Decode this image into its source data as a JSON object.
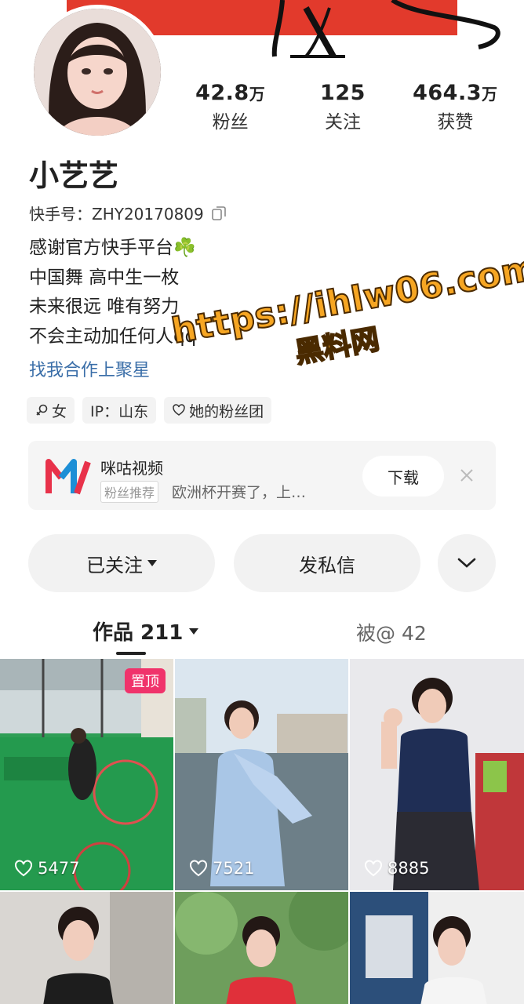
{
  "profile": {
    "name": "小艺艺",
    "kuaishou_id_label": "快手号：",
    "kuaishou_id": "ZHY20170809",
    "bio": [
      "感谢官方快手平台☘️",
      "中国舞 高中生一枚",
      "未来很远 唯有努力",
      "不会主动加任何人qq"
    ],
    "cooperate_link": "找我合作上聚星"
  },
  "stats": [
    {
      "num": "42.8",
      "unit": "万",
      "label": "粉丝"
    },
    {
      "num": "125",
      "unit": "",
      "label": "关注"
    },
    {
      "num": "464.3",
      "unit": "万",
      "label": "获赞"
    }
  ],
  "tags": [
    {
      "icon": "female-icon",
      "text": "女"
    },
    {
      "icon": "",
      "text": "IP：山东"
    },
    {
      "icon": "heart-outline-icon",
      "text": "她的粉丝团"
    }
  ],
  "watermark": {
    "url": "https://ihlw06.com",
    "sub": "黑料网"
  },
  "ad": {
    "title": "咪咕视频",
    "badge": "粉丝推荐",
    "desc": "欧洲杯开赛了，上…",
    "button": "下载"
  },
  "actions": {
    "follow": "已关注",
    "message": "发私信"
  },
  "tabs": {
    "works": "作品 211",
    "mentioned": "被@ 42"
  },
  "grid": [
    {
      "likes": "5477",
      "pinned": "置顶"
    },
    {
      "likes": "7521"
    },
    {
      "likes": "8885"
    },
    {
      "likes": ""
    },
    {
      "likes": ""
    },
    {
      "likes": ""
    }
  ],
  "colors": {
    "accent_link": "#3a6ea8",
    "pin_badge": "#f0336b",
    "watermark": "#f6a623"
  }
}
